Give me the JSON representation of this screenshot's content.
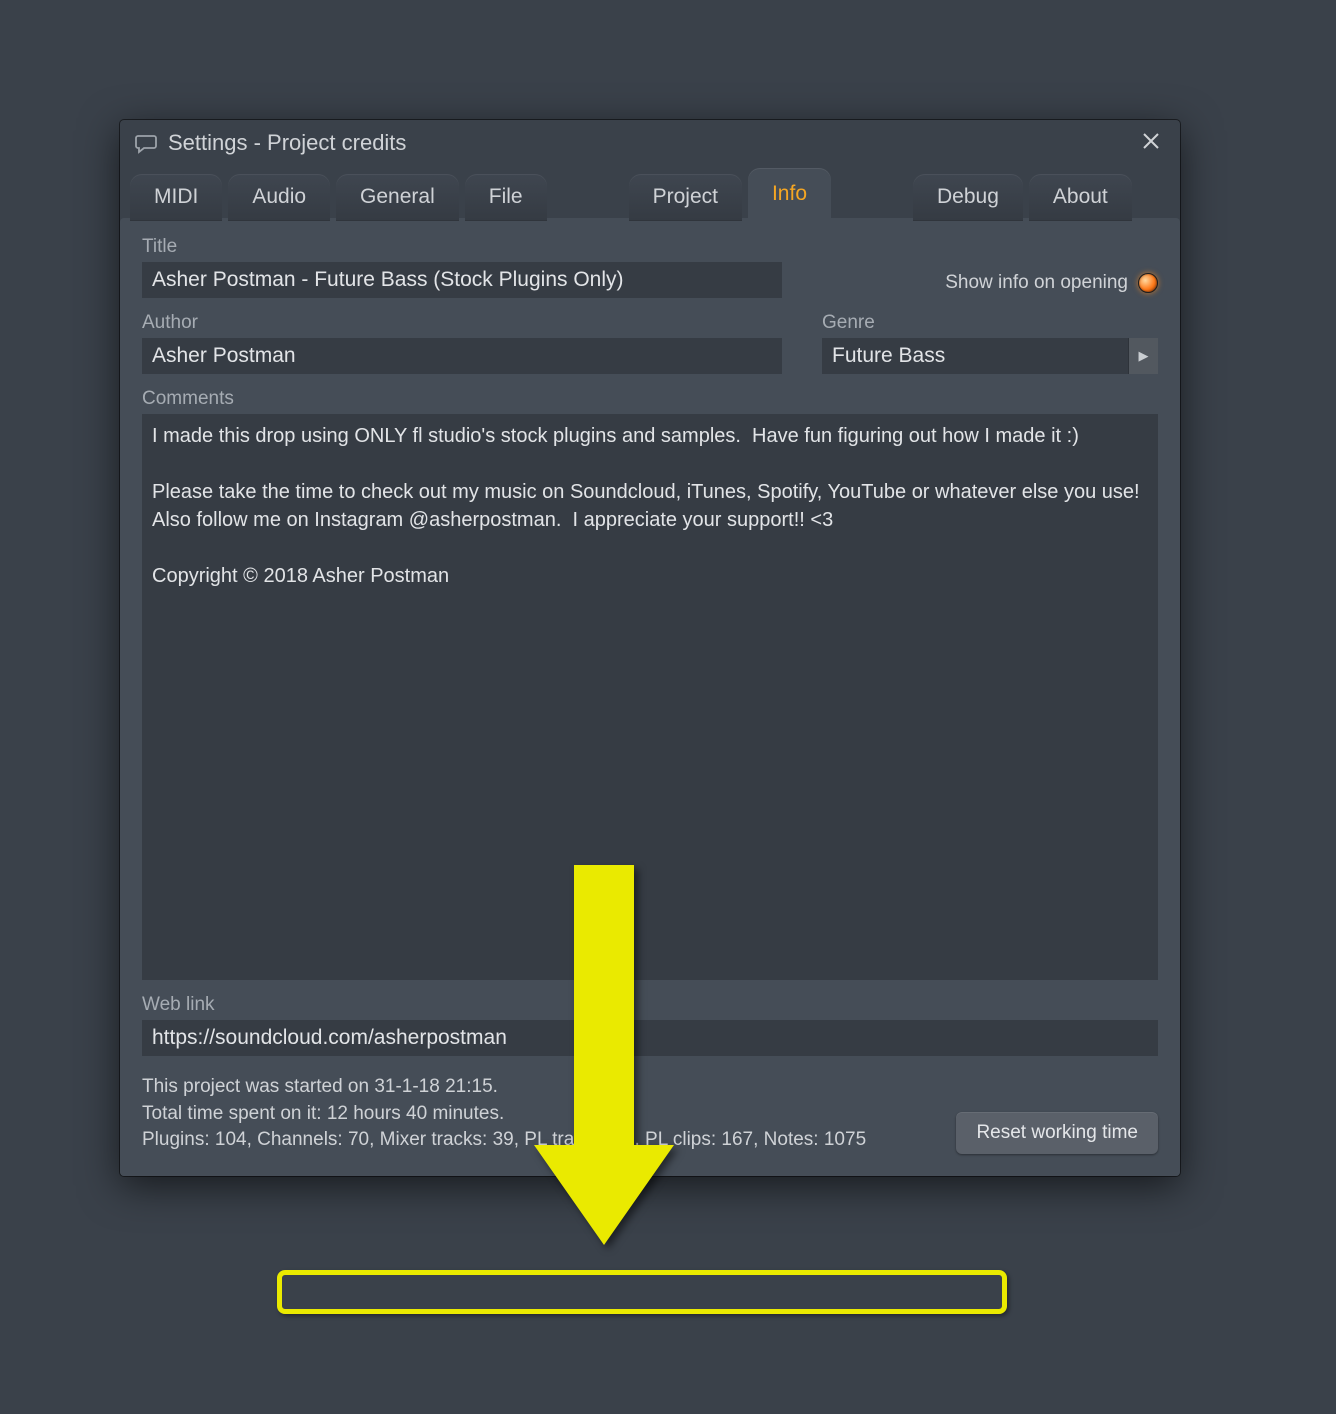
{
  "window": {
    "title": "Settings - Project credits"
  },
  "tabs": {
    "midi": "MIDI",
    "audio": "Audio",
    "general": "General",
    "file": "File",
    "project": "Project",
    "info": "Info",
    "debug": "Debug",
    "about": "About"
  },
  "labels": {
    "title": "Title",
    "author": "Author",
    "genre": "Genre",
    "comments": "Comments",
    "weblink": "Web link",
    "showinfo": "Show info on opening"
  },
  "fields": {
    "title": "Asher Postman - Future Bass (Stock Plugins Only)",
    "author": "Asher Postman",
    "genre": "Future Bass",
    "comments": "I made this drop using ONLY fl studio's stock plugins and samples.  Have fun figuring out how I made it :)\n\nPlease take the time to check out my music on Soundcloud, iTunes, Spotify, YouTube or whatever else you use!  Also follow me on Instagram @asherpostman.  I appreciate your support!! <3\n\nCopyright © 2018 Asher Postman",
    "weblink": "https://soundcloud.com/asherpostman"
  },
  "footer": {
    "started": "This project was started on 31-1-18 21:15.",
    "totaltime": "Total time spent on it: 12 hours 40 minutes.",
    "stats": "Plugins: 104, Channels: 70, Mixer tracks: 39, PL tracks: 19, PL clips: 167, Notes: 1075",
    "reset": "Reset working time"
  }
}
